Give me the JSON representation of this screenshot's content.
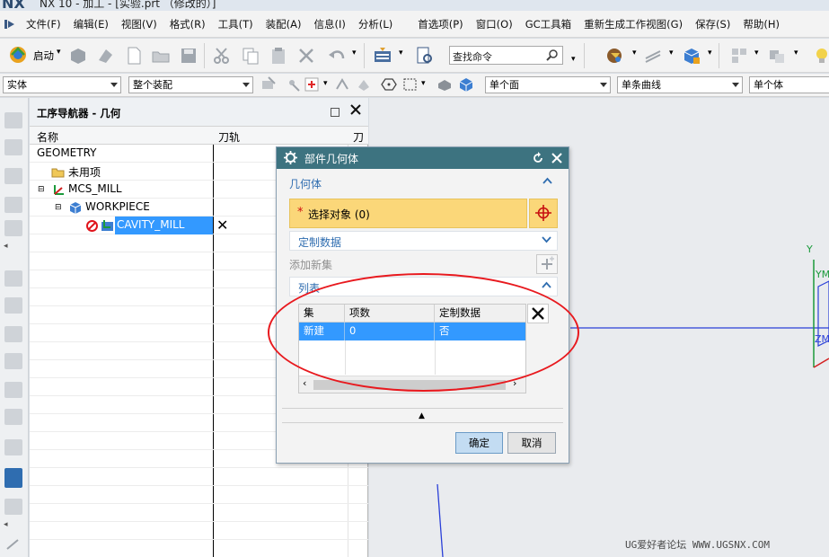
{
  "window": {
    "logo": "NX",
    "title": "NX 10 - 加工 - [实验.prt （修改的）]"
  },
  "menu": [
    {
      "label": "文件(F)"
    },
    {
      "label": "编辑(E)"
    },
    {
      "label": "视图(V)"
    },
    {
      "label": "格式(R)"
    },
    {
      "label": "工具(T)"
    },
    {
      "label": "装配(A)"
    },
    {
      "label": "信息(I)"
    },
    {
      "label": "分析(L)"
    },
    {
      "label": "首选项(P)"
    },
    {
      "label": "窗口(O)"
    },
    {
      "label": "GC工具箱"
    },
    {
      "label": "重新生成工作视图(G)"
    },
    {
      "label": "保存(S)"
    },
    {
      "label": "帮助(H)"
    }
  ],
  "toolbar": {
    "start_label": "启动",
    "search_placeholder": "查找命令"
  },
  "selection_bar": {
    "filter": "实体",
    "scope": "整个装配",
    "face_rule": "单个面",
    "curve_rule": "单条曲线",
    "body_rule": "单个体"
  },
  "navigator": {
    "title": "工序导航器 - 几何",
    "columns": [
      "名称",
      "刀轨",
      "刀"
    ],
    "rows": [
      {
        "label": "GEOMETRY"
      },
      {
        "label": "未用项"
      },
      {
        "label": "MCS_MILL"
      },
      {
        "label": "WORKPIECE"
      },
      {
        "label": "CAVITY_MILL",
        "toolpath": "✕",
        "selected": true
      }
    ]
  },
  "dialog": {
    "title": "部件几何体",
    "geometry_section": "几何体",
    "select_object": "选择对象 (0)",
    "custom_data": "定制数据",
    "add_new_set": "添加新集",
    "list_section": "列表",
    "table": {
      "headers": [
        "集",
        "项数",
        "定制数据"
      ],
      "rows": [
        {
          "set": "新建",
          "count": "0",
          "custom": "否"
        }
      ]
    },
    "ok": "确定",
    "cancel": "取消"
  },
  "viewport": {
    "axis_y": "Y",
    "axis_ym": "YM",
    "axis_zm": "ZM"
  },
  "watermark": "UG爱好者论坛 WWW.UGSNX.COM",
  "colors": {
    "dialog_header": "#3d7380",
    "selection": "#3399ff",
    "highlight_row": "#fbd779",
    "annotation": "#e8191e"
  }
}
